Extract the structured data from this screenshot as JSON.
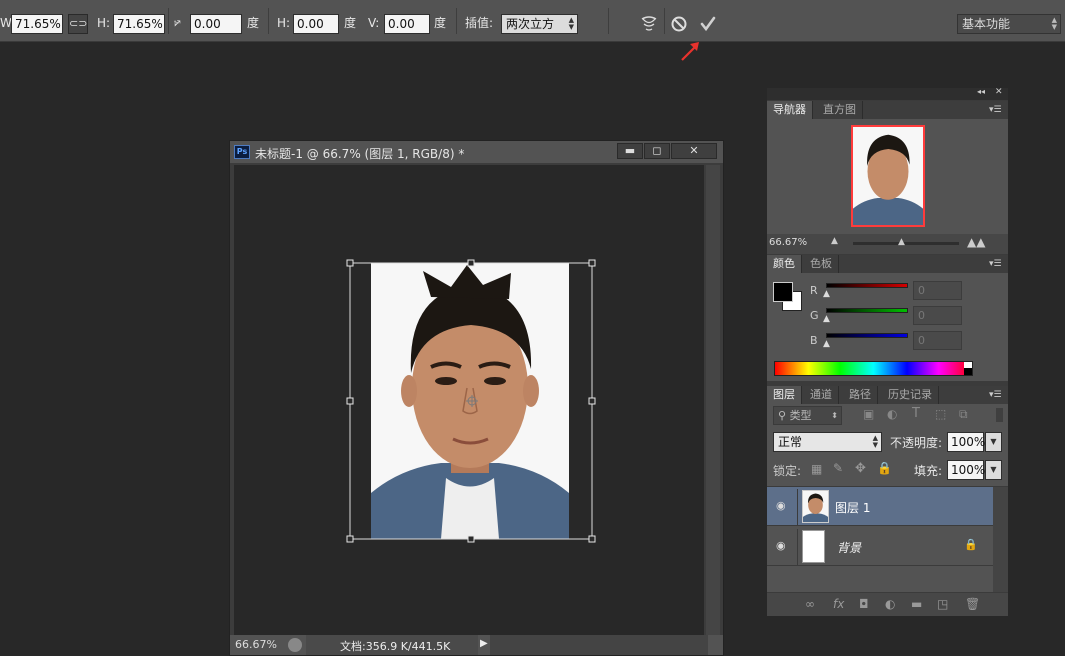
{
  "options_bar": {
    "w_label": "W:",
    "w_value": "71.65%",
    "h_label": "H:",
    "h_value": "71.65%",
    "angle_value": "0.00",
    "angle_unit": "度",
    "hskew_label": "H:",
    "hskew_value": "0.00",
    "hskew_unit": "度",
    "vskew_label": "V:",
    "vskew_value": "0.00",
    "vskew_unit": "度",
    "interp_label": "插值:",
    "interp_value": "两次立方",
    "workspace": "基本功能",
    "confirm_color": "#c8c8c8",
    "annotation_arrow_color": "#e8322d"
  },
  "document": {
    "title": "未标题-1 @ 66.7% (图层 1, RGB/8) *",
    "ps_badge": "Ps",
    "zoom": "66.67%",
    "doc_info": "文档:356.9 K/441.5K"
  },
  "navigator": {
    "tabs": [
      "导航器",
      "直方图"
    ],
    "zoom": "66.67%",
    "frame_color": "#ff3b3b"
  },
  "color_panel": {
    "tabs": [
      "颜色",
      "色板"
    ],
    "channels": [
      {
        "name": "R",
        "value": "0",
        "color": "#d40000"
      },
      {
        "name": "G",
        "value": "0",
        "color": "#00c000"
      },
      {
        "name": "B",
        "value": "0",
        "color": "#0000e0"
      }
    ]
  },
  "layers_panel": {
    "tabs": [
      "图层",
      "通道",
      "路径",
      "历史记录"
    ],
    "filter_label": "类型",
    "blend_mode": "正常",
    "opacity_label": "不透明度:",
    "opacity_value": "100%",
    "lock_label": "锁定:",
    "fill_label": "填充:",
    "fill_value": "100%",
    "layers": [
      {
        "name": "图层 1",
        "selected": true
      },
      {
        "name": "背景",
        "selected": false
      }
    ],
    "selected_color": "#5d6f8a"
  }
}
